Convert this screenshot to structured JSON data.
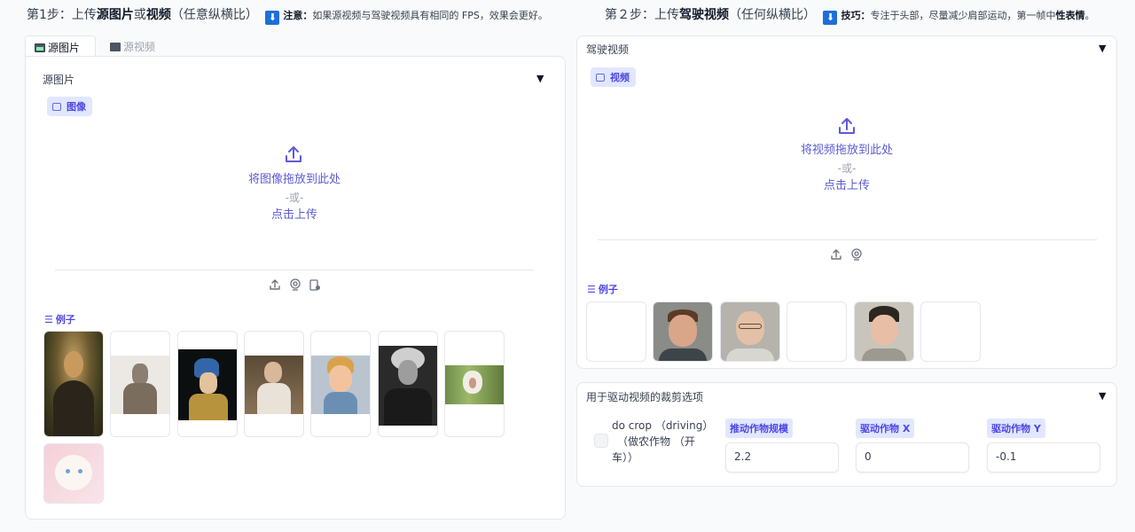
{
  "step1": {
    "prefix": "第1步：上传",
    "b1": "源图片",
    "mid": "或",
    "b2": "视频",
    "suffix": "（任意纵横比）",
    "badge": "⬇",
    "note_bold": "注意：",
    "note_text": "如果源视频与驾驶视频具有相同的 FPS，效果会更好。"
  },
  "step2": {
    "prefix": "第２步：上传",
    "b1": "驾驶视频",
    "suffix": "（任何纵横比）",
    "badge": "⬇",
    "note_bold": "技巧：",
    "note_text": "专注于头部，尽量减少肩部运动，第一帧中",
    "note_bold2": "性表情",
    "note_end": "。"
  },
  "tabs": {
    "source_image": "源图片",
    "source_video": "源视频"
  },
  "source_image": {
    "label": "源图片",
    "chip": "图像",
    "drop_main": "将图像拖放到此处",
    "drop_or": "-或-",
    "drop_click": "点击上传",
    "examples_label": "例子"
  },
  "driving_video": {
    "label": "驾驶视频",
    "chip": "视频",
    "drop_main": "将视频拖放到此处",
    "drop_or": "-或-",
    "drop_click": "点击上传",
    "examples_label": "例子"
  },
  "crop_options": {
    "label": "用于驱动视频的裁剪选项",
    "checkbox_label_line1": "do crop （driving）",
    "checkbox_label_line2": "（做农作物 （开",
    "checkbox_label_line3": "车））",
    "scale_label": "推动作物规模",
    "scale_value": "2.2",
    "x_label": "驱动作物 X",
    "x_value": "0",
    "y_label": "驱动作物 Y",
    "y_value": "-0.1"
  },
  "icons": {
    "collapse": "▼",
    "list": "☰"
  },
  "colors": {
    "accent": "#4f46e5",
    "chip_bg": "#e0e7ff",
    "badge": "#1d6fd8"
  }
}
